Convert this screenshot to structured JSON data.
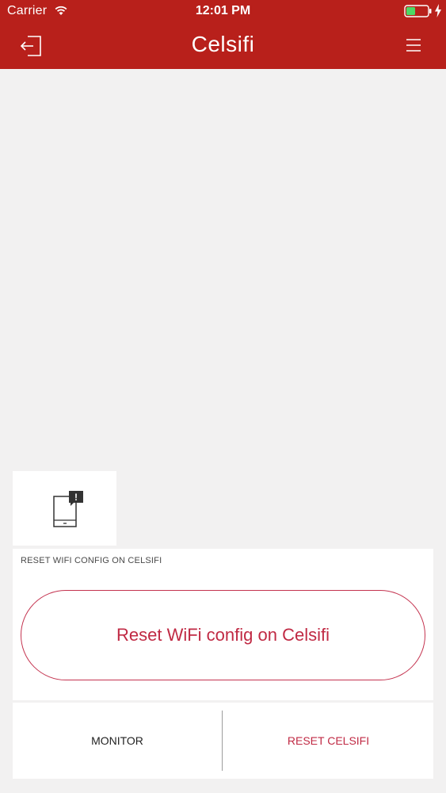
{
  "status_bar": {
    "carrier": "Carrier",
    "time": "12:01 PM",
    "battery_color": "#4cd964"
  },
  "nav": {
    "title": "Celsifi",
    "back_icon": "logout-icon",
    "menu_icon": "hamburger-menu-icon"
  },
  "widget": {
    "icon": "device-alert-icon",
    "badge": "!"
  },
  "reset_card": {
    "label": "RESET WIFI CONFIG ON CELSIFI",
    "button_label": "Reset WiFi config on Celsifi"
  },
  "tabs": [
    {
      "label": "MONITOR"
    },
    {
      "label": "RESET CELSIFI"
    }
  ],
  "colors": {
    "header": "#b8201b",
    "accent": "#c02a44",
    "background": "#f2f1f1"
  }
}
